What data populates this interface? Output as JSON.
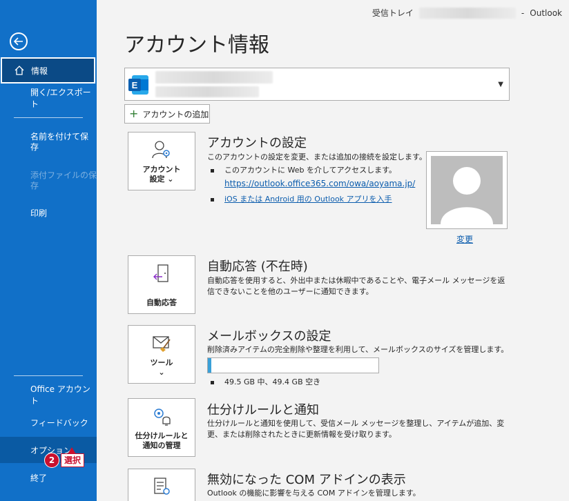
{
  "titlebar": {
    "folder": "受信トレイ",
    "separator": "-",
    "app": "Outlook"
  },
  "sidebar": {
    "info": "情報",
    "open_export": "開く/エクスポート",
    "save_as": "名前を付けて保\n存",
    "save_attachments": "添付ファイルの保\n存",
    "print": "印刷",
    "office_account": "Office アカウント",
    "feedback": "フィードバック",
    "options": "オプション",
    "exit": "終了"
  },
  "callout": {
    "number": "2",
    "label": "選択"
  },
  "page_title": "アカウント情報",
  "add_account": "アカウントの追加",
  "account_settings": {
    "tile_label_1": "アカウント",
    "tile_label_2": "設定 ⌄",
    "title": "アカウントの設定",
    "desc": "このアカウントの設定を変更、または追加の接続を設定します。",
    "bullet1": "このアカウントに Web を介してアクセスします。",
    "bullet1_link": "https://outlook.office365.com/owa/aoyama.jp/",
    "bullet2_link": "iOS または Android 用の Outlook アプリを入手",
    "change": "変更"
  },
  "auto_reply": {
    "tile_label": "自動応答",
    "title": "自動応答 (不在時)",
    "desc": "自動応答を使用すると、外出中または休暇中であることや、電子メール メッセージを返信できないことを他のユーザーに通知できます。"
  },
  "mailbox": {
    "tile_label": "ツール",
    "tile_caret": "⌄",
    "title": "メールボックスの設定",
    "desc": "削除済みアイテムの完全削除や整理を利用して、メールボックスのサイズを管理します。",
    "usage": "49.5 GB 中、49.4 GB 空き",
    "used_fraction": 0.02
  },
  "rules": {
    "tile_label_1": "仕分けルールと",
    "tile_label_2": "通知の管理",
    "title": "仕分けルールと通知",
    "desc": "仕分けルールと通知を使用して、受信メール メッセージを整理し、アイテムが追加、変更、または削除されたときに更新情報を受け取ります。"
  },
  "com": {
    "title": "無効になった COM アドインの表示",
    "desc": "Outlook の機能に影響を与える COM アドインを管理します。"
  },
  "colors": {
    "sidebar": "#1170c8",
    "active": "#0b4a86",
    "link": "#0b5cad",
    "callout": "#c8102e"
  }
}
